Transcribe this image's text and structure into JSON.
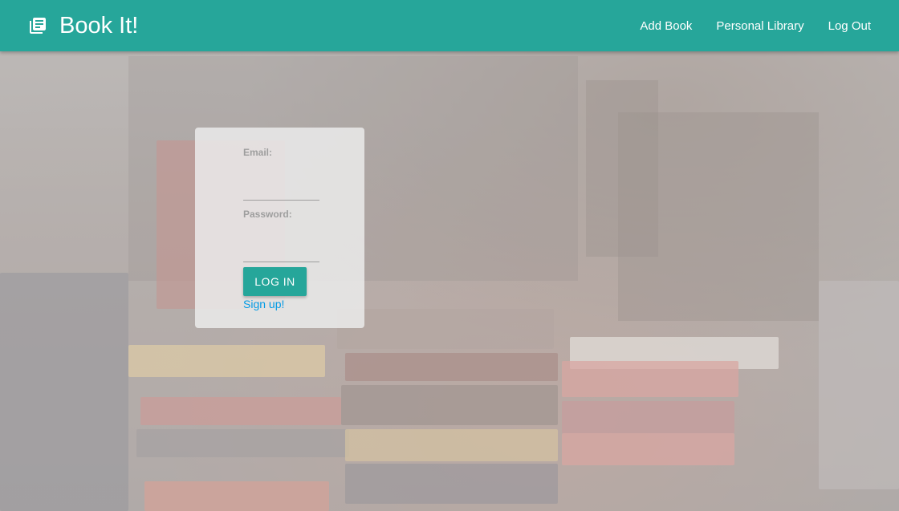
{
  "navbar": {
    "brand_title": "Book It!",
    "brand_icon": "library-books-icon",
    "links": [
      {
        "label": "Add Book"
      },
      {
        "label": "Personal Library"
      },
      {
        "label": "Log Out"
      }
    ],
    "color": "#26a69a"
  },
  "login": {
    "email_label": "Email:",
    "email_value": "",
    "password_label": "Password:",
    "password_value": "",
    "submit_label": "LOG IN",
    "signup_label": "Sign up!",
    "button_color": "#26a69a",
    "link_color": "#039be5"
  }
}
